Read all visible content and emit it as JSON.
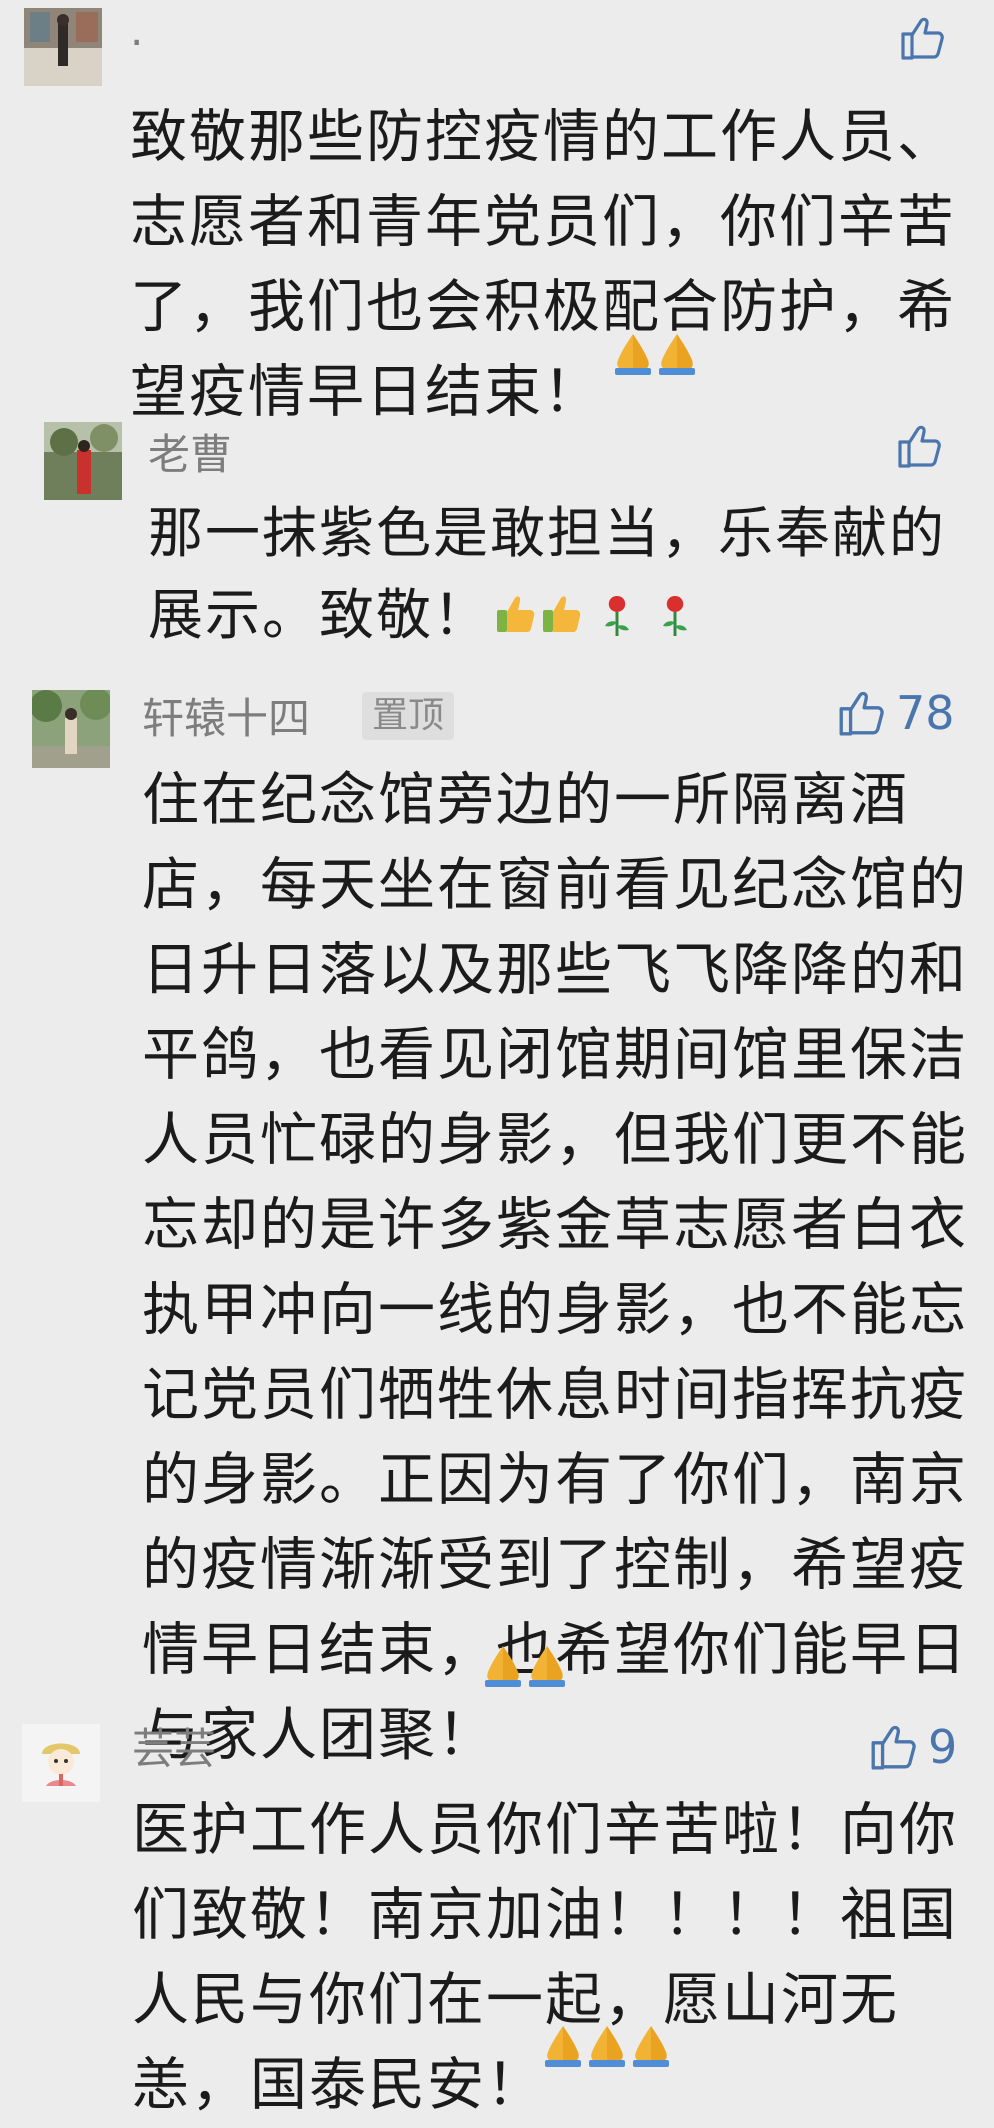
{
  "comments": [
    {
      "name": ".",
      "body": "致敬那些防控疫情的工作人员、\n志愿者和青年党员们，你们辛苦\n了，我们也会积极配合防护，希\n望疫情早日结束！",
      "like_count": "",
      "emoji": [
        "folded-hands",
        "folded-hands"
      ]
    },
    {
      "name": "老曹",
      "body": "那一抹紫色是敢担当，乐奉献的\n展示。致敬！",
      "like_count": "",
      "emoji": [
        "thumbs-up",
        "thumbs-up",
        "rose",
        "rose"
      ]
    },
    {
      "name": "轩辕十四",
      "pinned_label": "置顶",
      "body": "住在纪念馆旁边的一所隔离酒\n店，每天坐在窗前看见纪念馆的\n日升日落以及那些飞飞降降的和\n平鸽，也看见闭馆期间馆里保洁\n人员忙碌的身影，但我们更不能\n忘却的是许多紫金草志愿者白衣\n执甲冲向一线的身影，也不能忘\n记党员们牺牲休息时间指挥抗疫\n的身影。正因为有了你们，南京\n的疫情渐渐受到了控制，希望疫\n情早日结束，也希望你们能早日\n与家人团聚！",
      "like_count": "78",
      "emoji": [
        "folded-hands",
        "folded-hands"
      ]
    },
    {
      "name": "芸芸",
      "body": "医护工作人员你们辛苦啦！向你\n们致敬！南京加油！！！！祖国\n人民与你们在一起，愿山河无\n恙，国泰民安！",
      "like_count": "9",
      "emoji": [
        "folded-hands",
        "folded-hands",
        "folded-hands"
      ]
    }
  ],
  "colors": {
    "background": "#ececec",
    "text": "#1b1b1b",
    "name": "#7d7d7d",
    "like": "#3f6ea8"
  }
}
